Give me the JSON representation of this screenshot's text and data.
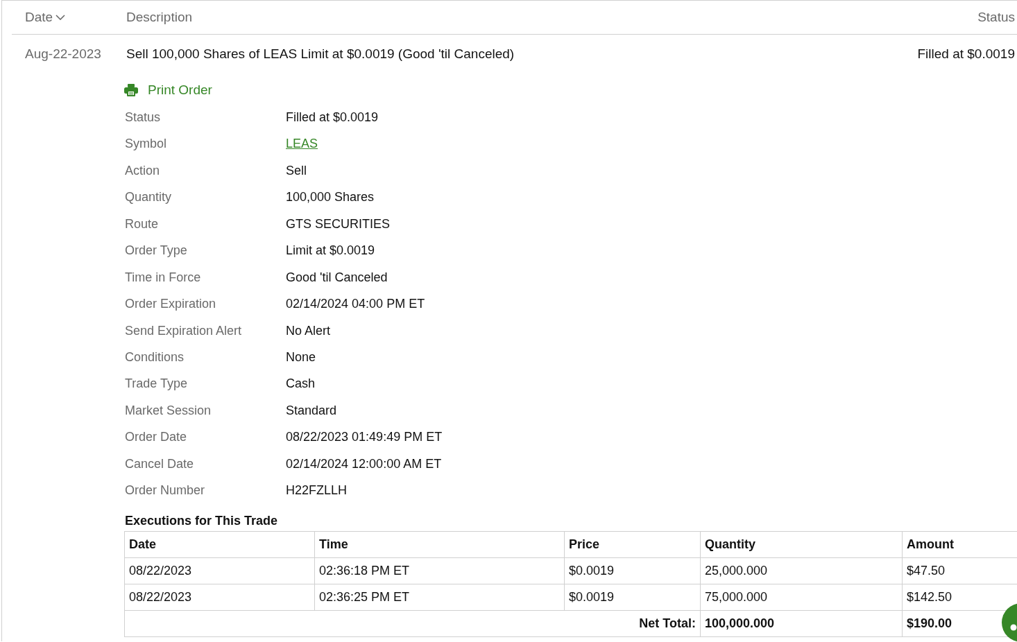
{
  "table": {
    "columns": [
      {
        "label": "Date",
        "sorted": true
      },
      {
        "label": "Description",
        "sorted": false
      },
      {
        "label": "Status",
        "sorted": false
      }
    ],
    "rows": [
      {
        "date": "Aug-22-2023",
        "description": "Sell 100,000 Shares of LEAS Limit at $0.0019 (Good 'til Canceled)",
        "status": "Filled at $0.0019",
        "details": {
          "print_link": "Print Order",
          "fields": [
            {
              "label": "Status",
              "value": "Filled at $0.0019",
              "kind": "text"
            },
            {
              "label": "Symbol",
              "value": "LEAS",
              "kind": "link"
            },
            {
              "label": "Action",
              "value": "Sell",
              "kind": "text"
            },
            {
              "label": "Quantity",
              "value": "100,000 Shares",
              "kind": "text"
            },
            {
              "label": "Route",
              "value": "GTS SECURITIES",
              "kind": "text"
            },
            {
              "label": "Order Type",
              "value": "Limit at $0.0019",
              "kind": "text"
            },
            {
              "label": "Time in Force",
              "value": "Good 'til Canceled",
              "kind": "text"
            },
            {
              "label": "Order Expiration",
              "value": "02/14/2024 04:00 PM ET",
              "kind": "text"
            },
            {
              "label": "Send Expiration Alert",
              "value": "No Alert",
              "kind": "text"
            },
            {
              "label": "Conditions",
              "value": "None",
              "kind": "text"
            },
            {
              "label": "Trade Type",
              "value": "Cash",
              "kind": "text"
            },
            {
              "label": "Market Session",
              "value": "Standard",
              "kind": "text"
            },
            {
              "label": "Order Date",
              "value": "08/22/2023 01:49:49 PM ET",
              "kind": "text"
            },
            {
              "label": "Cancel Date",
              "value": "02/14/2024 12:00:00 AM ET",
              "kind": "text"
            },
            {
              "label": "Order Number",
              "value": "H22FZLLH",
              "kind": "text"
            }
          ],
          "executions": {
            "title": "Executions for This Trade",
            "columns": [
              "Date",
              "Time",
              "Price",
              "Quantity",
              "Amount"
            ],
            "rows": [
              [
                "08/22/2023",
                "02:36:18 PM ET",
                "$0.0019",
                "25,000.000",
                "$47.50"
              ],
              [
                "08/22/2023",
                "02:36:25 PM ET",
                "$0.0019",
                "75,000.000",
                "$142.50"
              ]
            ],
            "total": {
              "label": "Net Total:",
              "quantity": "100,000.000",
              "amount": "$190.00"
            }
          }
        }
      }
    ]
  }
}
